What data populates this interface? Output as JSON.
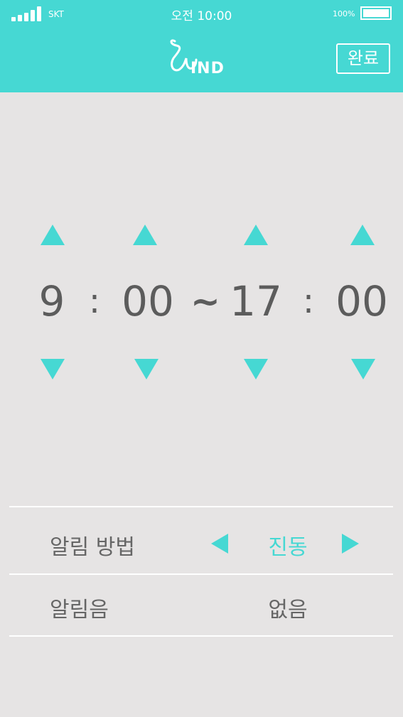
{
  "status_bar": {
    "carrier": "SKT",
    "time": "오전 10:00",
    "battery": "100%"
  },
  "header": {
    "logo_text": "IND",
    "done_label": "완료"
  },
  "time_range": {
    "start_hour": "9",
    "start_minute": "00",
    "separator": "~",
    "end_hour": "17",
    "end_minute": "00",
    "colon": ":"
  },
  "settings": {
    "alert_method": {
      "label": "알림 방법",
      "value": "진동"
    },
    "alert_sound": {
      "label": "알림음",
      "value": "없음"
    }
  },
  "colors": {
    "accent": "#46d8d3",
    "background": "#e6e4e4",
    "text": "#5c5c5c"
  }
}
